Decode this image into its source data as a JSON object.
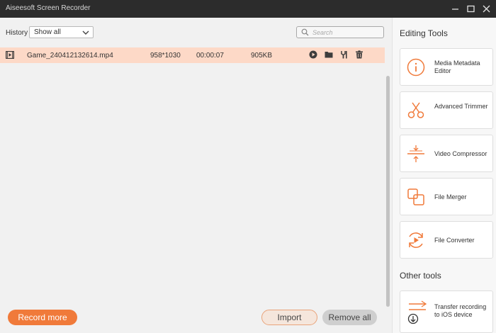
{
  "app": {
    "title": "Aiseesoft Screen Recorder"
  },
  "toolbar": {
    "history_label": "History",
    "filter_value": "Show all",
    "search_placeholder": "Search"
  },
  "recordings": [
    {
      "name": "Game_240412132614.mp4",
      "resolution": "958*1030",
      "duration": "00:00:07",
      "size": "905KB"
    }
  ],
  "buttons": {
    "record_more": "Record more",
    "import": "Import",
    "remove_all": "Remove all"
  },
  "editing_tools": {
    "title": "Editing Tools",
    "items": [
      {
        "label": "Media Metadata Editor",
        "icon": "info-icon"
      },
      {
        "label": "Advanced Trimmer",
        "icon": "scissors-icon"
      },
      {
        "label": "Video Compressor",
        "icon": "compress-icon"
      },
      {
        "label": "File Merger",
        "icon": "merge-icon"
      },
      {
        "label": "File Converter",
        "icon": "convert-icon"
      }
    ]
  },
  "other_tools": {
    "title": "Other tools",
    "items": [
      {
        "label": "Transfer recording to iOS device",
        "icon": "transfer-icon"
      }
    ]
  },
  "colors": {
    "accent": "#f07a3a",
    "selected_row": "#fdd9c7",
    "titlebar": "#2c2c2c"
  }
}
